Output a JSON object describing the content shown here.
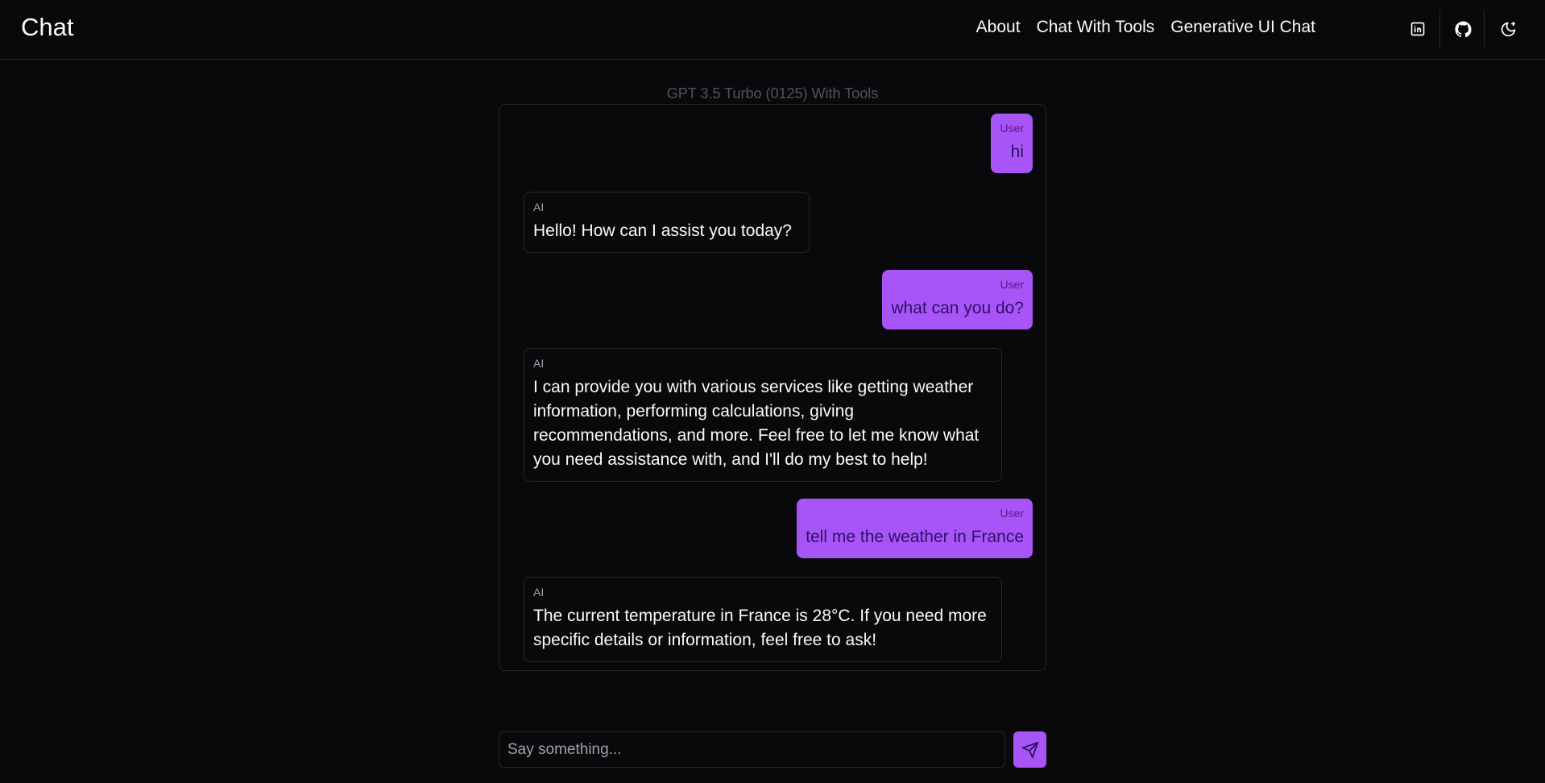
{
  "app": {
    "brand": "Chat"
  },
  "nav": {
    "items": [
      {
        "label": "About"
      },
      {
        "label": "Chat With Tools"
      },
      {
        "label": "Generative UI Chat"
      }
    ]
  },
  "header_icons": [
    "linkedin-icon",
    "github-icon",
    "theme-toggle-icon"
  ],
  "model": {
    "label": "GPT 3.5 Turbo (0125) With Tools"
  },
  "messages": [
    {
      "role": "User",
      "text": "hi"
    },
    {
      "role": "AI",
      "text": "Hello! How can I assist you today?"
    },
    {
      "role": "User",
      "text": "what can you do?"
    },
    {
      "role": "AI",
      "text": "I can provide you with various services like getting weather information, performing calculations, giving recommendations, and more. Feel free to let me know what you need assistance with, and I'll do my best to help!"
    },
    {
      "role": "User",
      "text": "tell me the weather in France"
    },
    {
      "role": "AI",
      "text": "The current temperature in France is 28°C. If you need more specific details or information, feel free to ask!"
    }
  ],
  "composer": {
    "placeholder": "Say something...",
    "value": ""
  },
  "colors": {
    "background": "#09090b",
    "accent": "#a855f7",
    "border": "#27272a"
  }
}
